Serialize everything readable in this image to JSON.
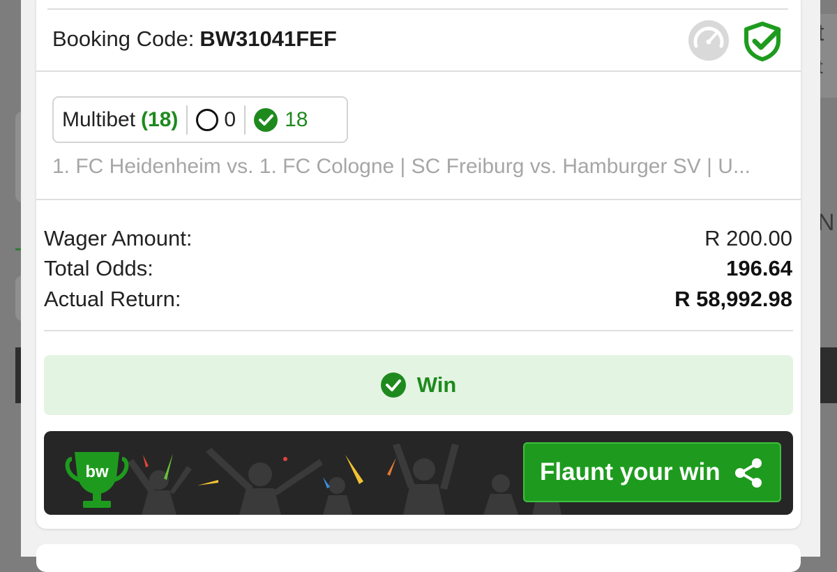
{
  "booking": {
    "label": "Booking Code:",
    "code": "BW31041FEF"
  },
  "icons": {
    "gauge": "speedometer-icon",
    "shield": "shield-check-icon"
  },
  "multibet": {
    "label": "Multibet",
    "count": "(18)",
    "open": "0",
    "won": "18"
  },
  "matches_summary": "1. FC Heidenheim vs. 1. FC Cologne | SC Freiburg vs. Hamburger SV | U...",
  "summary": {
    "wager_label": "Wager Amount:",
    "wager_value": "R 200.00",
    "odds_label": "Total Odds:",
    "odds_value": "196.64",
    "return_label": "Actual Return:",
    "return_value": "R 58,992.98"
  },
  "result": {
    "label": "Win"
  },
  "banner": {
    "logo_text": "bw",
    "button_label": "Flaunt your win"
  },
  "background": {
    "right_glyph_1": "t",
    "right_glyph_2": "N"
  },
  "colors": {
    "accent": "#1e8a1e",
    "win_bg": "#e4f4e2",
    "banner_bg": "#262626"
  }
}
